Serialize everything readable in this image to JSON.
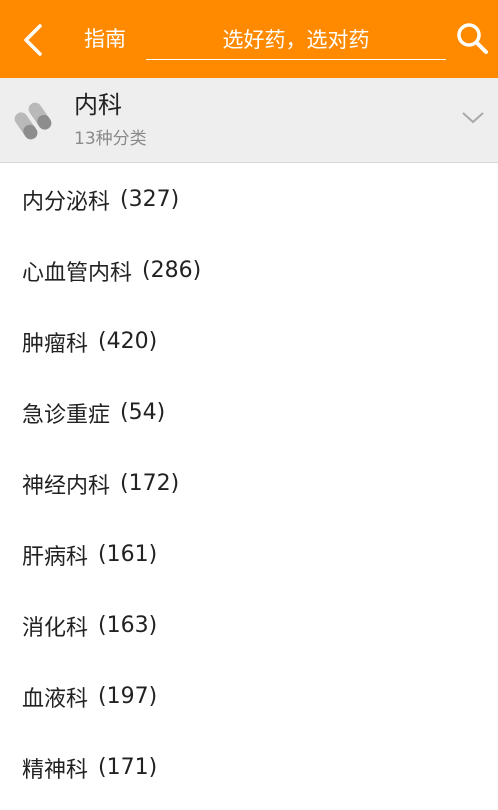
{
  "header": {
    "title": "指南",
    "search_placeholder": "选好药，选对药"
  },
  "category": {
    "name": "内科",
    "subtitle": "13种分类"
  },
  "items": [
    {
      "label": "内分泌科",
      "count": "(327)"
    },
    {
      "label": "心血管内科",
      "count": "(286)"
    },
    {
      "label": "肿瘤科",
      "count": "(420)"
    },
    {
      "label": "急诊重症",
      "count": "(54)"
    },
    {
      "label": "神经内科",
      "count": "(172)"
    },
    {
      "label": "肝病科",
      "count": "(161)"
    },
    {
      "label": "消化科",
      "count": "(163)"
    },
    {
      "label": "血液科",
      "count": "(197)"
    },
    {
      "label": "精神科",
      "count": "(171)"
    }
  ],
  "colors": {
    "accent": "#ff8a00",
    "header_bg": "#eeeeee"
  },
  "icons": [
    "back-arrow-icon",
    "search-icon",
    "pill-icon",
    "chevron-down-icon"
  ]
}
